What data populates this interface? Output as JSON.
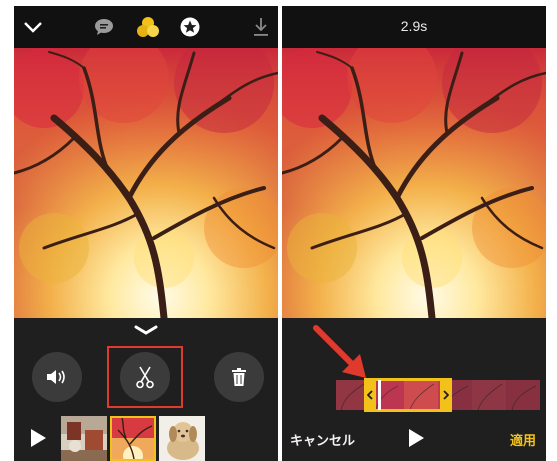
{
  "left_panel": {
    "toolbar": {
      "collapse_icon": "chevron-down-icon",
      "comment_icon": "speech-bubble-icon",
      "filters_icon": "filters-icon",
      "favorite_icon": "star-icon",
      "download_icon": "download-icon"
    },
    "tools": {
      "volume_icon": "speaker-icon",
      "cut_icon": "scissors-icon",
      "delete_icon": "trash-icon",
      "highlight_color": "#e03a2f"
    },
    "thumbnails": [
      {
        "name": "thumb-room",
        "selected": false
      },
      {
        "name": "thumb-tree",
        "selected": true
      },
      {
        "name": "thumb-dog",
        "selected": false
      }
    ]
  },
  "right_panel": {
    "duration": "2.9s",
    "cancel_label": "キャンセル",
    "apply_label": "適用",
    "accent_color": "#f2c21a",
    "arrow_color": "#e03a2f"
  }
}
